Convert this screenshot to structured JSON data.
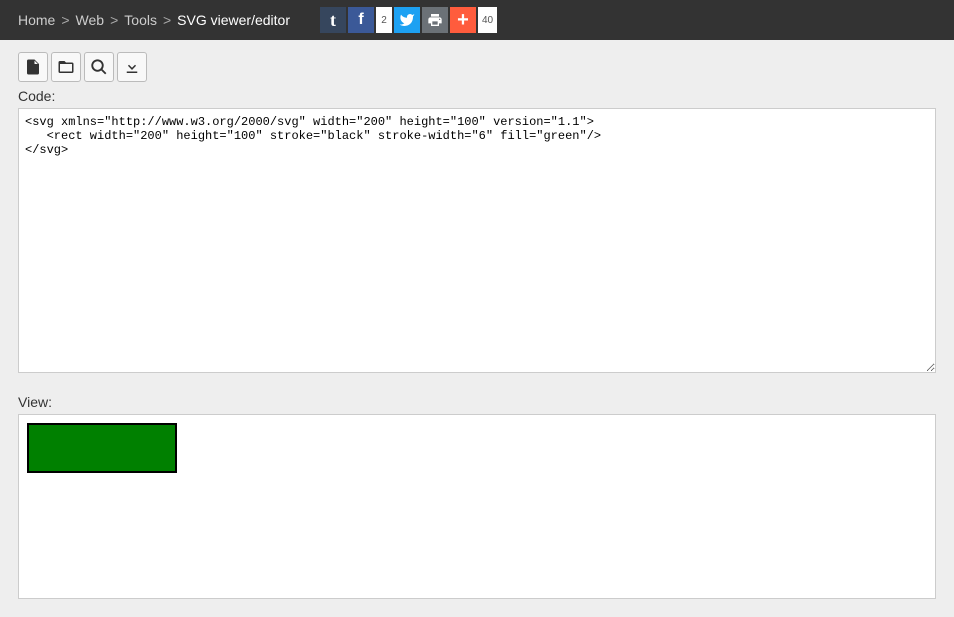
{
  "breadcrumb": {
    "home": "Home",
    "sep": ">",
    "web": "Web",
    "tools": "Tools",
    "current": "SVG viewer/editor"
  },
  "social": {
    "tumblr_label": "t",
    "facebook_label": "f",
    "facebook_count": "2",
    "print_label": "print",
    "share_label": "+",
    "share_count": "40"
  },
  "labels": {
    "code": "Code:",
    "view": "View:"
  },
  "code": "<svg xmlns=\"http://www.w3.org/2000/svg\" width=\"200\" height=\"100\" version=\"1.1\">\n   <rect width=\"200\" height=\"100\" stroke=\"black\" stroke-width=\"6\" fill=\"green\"/>\n</svg>",
  "svg": {
    "width": 150,
    "height": 50,
    "stroke": "black",
    "stroke_width": 4,
    "fill": "green"
  }
}
